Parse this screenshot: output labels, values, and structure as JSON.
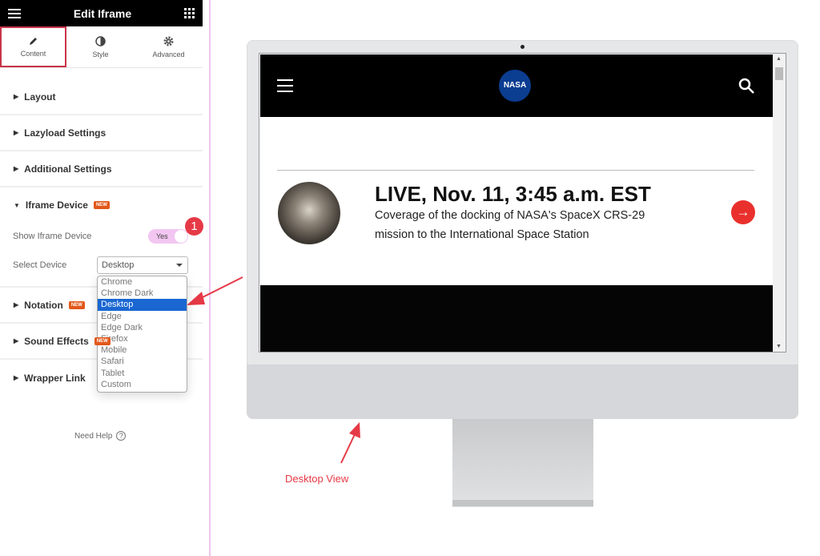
{
  "panel": {
    "title": "Edit Iframe",
    "tabs": [
      {
        "label": "Content",
        "icon": "pencil-icon",
        "active": true
      },
      {
        "label": "Style",
        "icon": "half-circle-icon"
      },
      {
        "label": "Advanced",
        "icon": "gear-icon"
      }
    ],
    "sections": [
      {
        "label": "Layout"
      },
      {
        "label": "Lazyload Settings"
      },
      {
        "label": "Additional Settings"
      }
    ],
    "iframe_device": {
      "label": "Iframe Device",
      "badge": "NEW",
      "show_label": "Show Iframe Device",
      "toggle_value": "Yes",
      "toggle_on": true,
      "step": "1",
      "select_label": "Select Device",
      "select_value": "Desktop",
      "options": [
        "Chrome",
        "Chrome Dark",
        "Desktop",
        "Edge",
        "Edge Dark",
        "Firefox",
        "Mobile",
        "Safari",
        "Tablet",
        "Custom"
      ]
    },
    "sections2": [
      {
        "label": "Notation",
        "badge": "NEW"
      },
      {
        "label": "Sound Effects",
        "badge": "NEW"
      },
      {
        "label": "Wrapper Link"
      }
    ],
    "help": "Need Help"
  },
  "preview": {
    "logo": "NASA",
    "headline": "LIVE, Nov. 11, 3:45 a.m. EST",
    "description": "Coverage of the docking of NASA's SpaceX CRS-29 mission to the International Space Station",
    "annotation": "Desktop View"
  },
  "colors": {
    "accent": "#e63946",
    "toggle": "#f2c6f1",
    "highlight": "#1a67d2",
    "badge": "#e2581b"
  }
}
